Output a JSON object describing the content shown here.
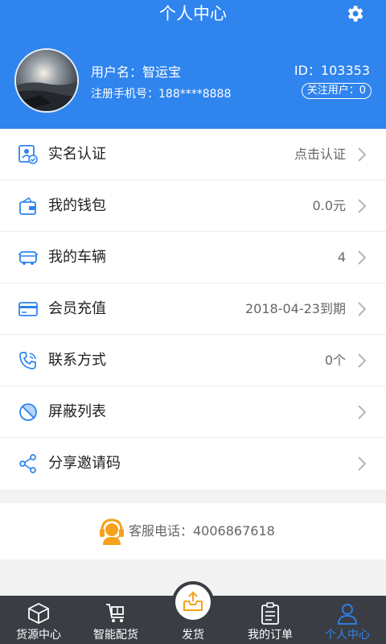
{
  "header": {
    "title": "个人中心",
    "settings_icon": "gear-icon",
    "username": "用户名：智运宝",
    "phone": "注册手机号：188****8888",
    "user_id": "ID：103353",
    "follow": "关注用户：0"
  },
  "menu": [
    {
      "label": "实名认证",
      "value": "点击认证",
      "icon": "id-card-icon"
    },
    {
      "label": "我的钱包",
      "value": "0.0元",
      "icon": "wallet-icon"
    },
    {
      "label": "我的车辆",
      "value": "4",
      "icon": "truck-icon"
    },
    {
      "label": "会员充值",
      "value": "2018-04-23到期",
      "icon": "card-icon"
    },
    {
      "label": "联系方式",
      "value": "0个",
      "icon": "phone-icon"
    },
    {
      "label": "屏蔽列表",
      "value": "",
      "icon": "block-icon"
    },
    {
      "label": "分享邀请码",
      "value": "",
      "icon": "share-icon"
    }
  ],
  "hotline": {
    "text": "客服电话：4006867618",
    "icon": "customer-service-icon"
  },
  "tabs": [
    {
      "label": "货源中心",
      "icon": "box-icon"
    },
    {
      "label": "智能配货",
      "icon": "cart-icon"
    },
    {
      "label": "发货",
      "icon": "upload-tray-icon"
    },
    {
      "label": "我的订单",
      "icon": "clipboard-icon"
    },
    {
      "label": "个人中心",
      "icon": "person-icon",
      "active": true
    }
  ],
  "colors": {
    "primary": "#2f84ee",
    "tabbar": "#3a3d44",
    "accent": "#f5a21b"
  }
}
